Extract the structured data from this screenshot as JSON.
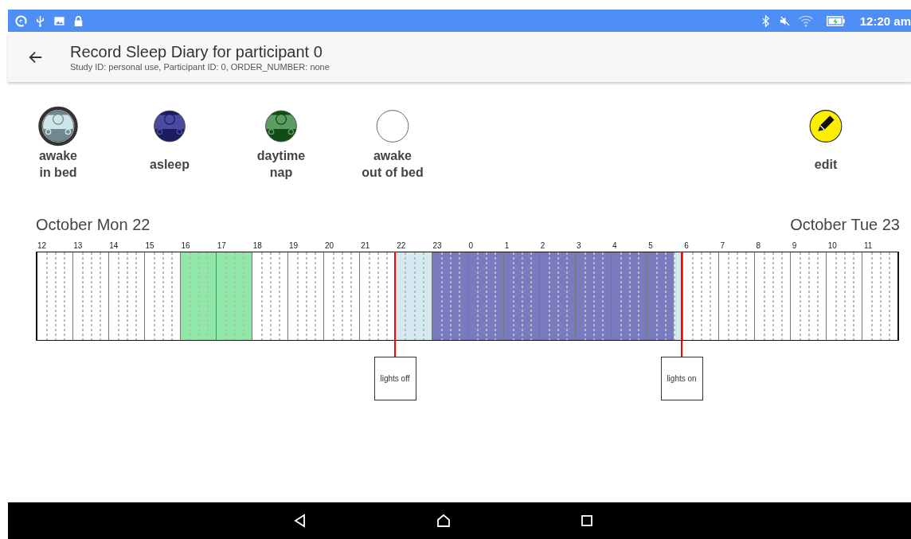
{
  "status_bar": {
    "time": "12:20 am"
  },
  "app_bar": {
    "title": "Record Sleep Diary for participant 0",
    "subtitle": "Study ID: personal use, Participant ID: 0, ORDER_NUMBER: none"
  },
  "legend": [
    {
      "kind": "awake_in_bed",
      "label": "awake\nin bed",
      "selected": true
    },
    {
      "kind": "asleep",
      "label": "asleep",
      "selected": false
    },
    {
      "kind": "nap",
      "label": "daytime\nnap",
      "selected": false
    },
    {
      "kind": "out_of_bed",
      "label": "awake\nout of bed",
      "selected": false
    },
    {
      "kind": "edit",
      "label": "edit",
      "selected": false
    }
  ],
  "dates": {
    "start": "October Mon 22",
    "end": "October Tue 23"
  },
  "timeline": {
    "hours": [
      {
        "label": "12",
        "quarters": [
          {
            "kind": "none"
          },
          {
            "kind": "none"
          },
          {
            "kind": "none"
          },
          {
            "kind": "none"
          }
        ]
      },
      {
        "label": "13",
        "quarters": [
          {
            "kind": "none"
          },
          {
            "kind": "none"
          },
          {
            "kind": "none"
          },
          {
            "kind": "none"
          }
        ]
      },
      {
        "label": "14",
        "quarters": [
          {
            "kind": "none"
          },
          {
            "kind": "none"
          },
          {
            "kind": "none"
          },
          {
            "kind": "none"
          }
        ]
      },
      {
        "label": "15",
        "quarters": [
          {
            "kind": "none"
          },
          {
            "kind": "none"
          },
          {
            "kind": "none"
          },
          {
            "kind": "none"
          }
        ]
      },
      {
        "label": "16",
        "quarters": [
          {
            "kind": "nap"
          },
          {
            "kind": "nap"
          },
          {
            "kind": "nap"
          },
          {
            "kind": "nap"
          }
        ]
      },
      {
        "label": "17",
        "quarters": [
          {
            "kind": "nap"
          },
          {
            "kind": "nap"
          },
          {
            "kind": "nap"
          },
          {
            "kind": "nap"
          }
        ]
      },
      {
        "label": "18",
        "quarters": [
          {
            "kind": "none"
          },
          {
            "kind": "none"
          },
          {
            "kind": "none"
          },
          {
            "kind": "none"
          }
        ]
      },
      {
        "label": "19",
        "quarters": [
          {
            "kind": "none"
          },
          {
            "kind": "none"
          },
          {
            "kind": "none"
          },
          {
            "kind": "none"
          }
        ]
      },
      {
        "label": "20",
        "quarters": [
          {
            "kind": "none"
          },
          {
            "kind": "none"
          },
          {
            "kind": "none"
          },
          {
            "kind": "none"
          }
        ]
      },
      {
        "label": "21",
        "quarters": [
          {
            "kind": "none"
          },
          {
            "kind": "none"
          },
          {
            "kind": "none"
          },
          {
            "kind": "none"
          }
        ]
      },
      {
        "label": "22",
        "marker": "lights off",
        "quarters": [
          {
            "kind": "awake_in_bed"
          },
          {
            "kind": "awake_in_bed"
          },
          {
            "kind": "awake_in_bed"
          },
          {
            "kind": "awake_in_bed"
          }
        ]
      },
      {
        "label": "23",
        "quarters": [
          {
            "kind": "asleep"
          },
          {
            "kind": "asleep"
          },
          {
            "kind": "asleep"
          },
          {
            "kind": "asleep"
          }
        ]
      },
      {
        "label": "0",
        "quarters": [
          {
            "kind": "asleep"
          },
          {
            "kind": "asleep"
          },
          {
            "kind": "asleep"
          },
          {
            "kind": "asleep"
          }
        ]
      },
      {
        "label": "1",
        "quarters": [
          {
            "kind": "asleep"
          },
          {
            "kind": "asleep"
          },
          {
            "kind": "asleep"
          },
          {
            "kind": "asleep"
          }
        ]
      },
      {
        "label": "2",
        "quarters": [
          {
            "kind": "asleep"
          },
          {
            "kind": "asleep"
          },
          {
            "kind": "asleep"
          },
          {
            "kind": "asleep"
          }
        ]
      },
      {
        "label": "3",
        "quarters": [
          {
            "kind": "asleep"
          },
          {
            "kind": "asleep"
          },
          {
            "kind": "asleep"
          },
          {
            "kind": "asleep"
          }
        ]
      },
      {
        "label": "4",
        "quarters": [
          {
            "kind": "asleep"
          },
          {
            "kind": "asleep"
          },
          {
            "kind": "asleep"
          },
          {
            "kind": "asleep"
          }
        ]
      },
      {
        "label": "5",
        "quarters": [
          {
            "kind": "asleep"
          },
          {
            "kind": "asleep"
          },
          {
            "kind": "asleep"
          },
          {
            "kind": "awake_in_bed"
          }
        ]
      },
      {
        "label": "6",
        "marker": "lights on",
        "quarters": [
          {
            "kind": "none"
          },
          {
            "kind": "none"
          },
          {
            "kind": "none"
          },
          {
            "kind": "none"
          }
        ]
      },
      {
        "label": "7",
        "quarters": [
          {
            "kind": "none"
          },
          {
            "kind": "none"
          },
          {
            "kind": "none"
          },
          {
            "kind": "none"
          }
        ]
      },
      {
        "label": "8",
        "quarters": [
          {
            "kind": "none"
          },
          {
            "kind": "none"
          },
          {
            "kind": "none"
          },
          {
            "kind": "none"
          }
        ]
      },
      {
        "label": "9",
        "quarters": [
          {
            "kind": "none"
          },
          {
            "kind": "none"
          },
          {
            "kind": "none"
          },
          {
            "kind": "none"
          }
        ]
      },
      {
        "label": "10",
        "quarters": [
          {
            "kind": "none"
          },
          {
            "kind": "none"
          },
          {
            "kind": "none"
          },
          {
            "kind": "none"
          }
        ]
      },
      {
        "label": "11",
        "quarters": [
          {
            "kind": "none"
          },
          {
            "kind": "none"
          },
          {
            "kind": "none"
          },
          {
            "kind": "none"
          }
        ]
      }
    ]
  }
}
